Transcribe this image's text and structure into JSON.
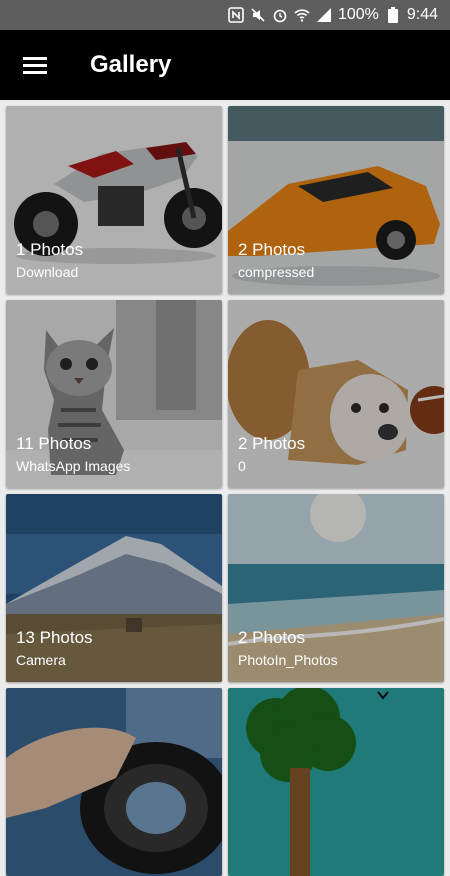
{
  "status": {
    "battery": "100%",
    "time": "9:44"
  },
  "appbar": {
    "title": "Gallery"
  },
  "albums": [
    {
      "count": "1 Photos",
      "name": "Download"
    },
    {
      "count": "2 Photos",
      "name": "compressed"
    },
    {
      "count": "11 Photos",
      "name": "WhatsApp Images"
    },
    {
      "count": "2 Photos",
      "name": "0"
    },
    {
      "count": "13 Photos",
      "name": "Camera"
    },
    {
      "count": "2 Photos",
      "name": "PhotoIn_Photos"
    },
    {
      "count": "",
      "name": ""
    },
    {
      "count": "",
      "name": ""
    }
  ]
}
